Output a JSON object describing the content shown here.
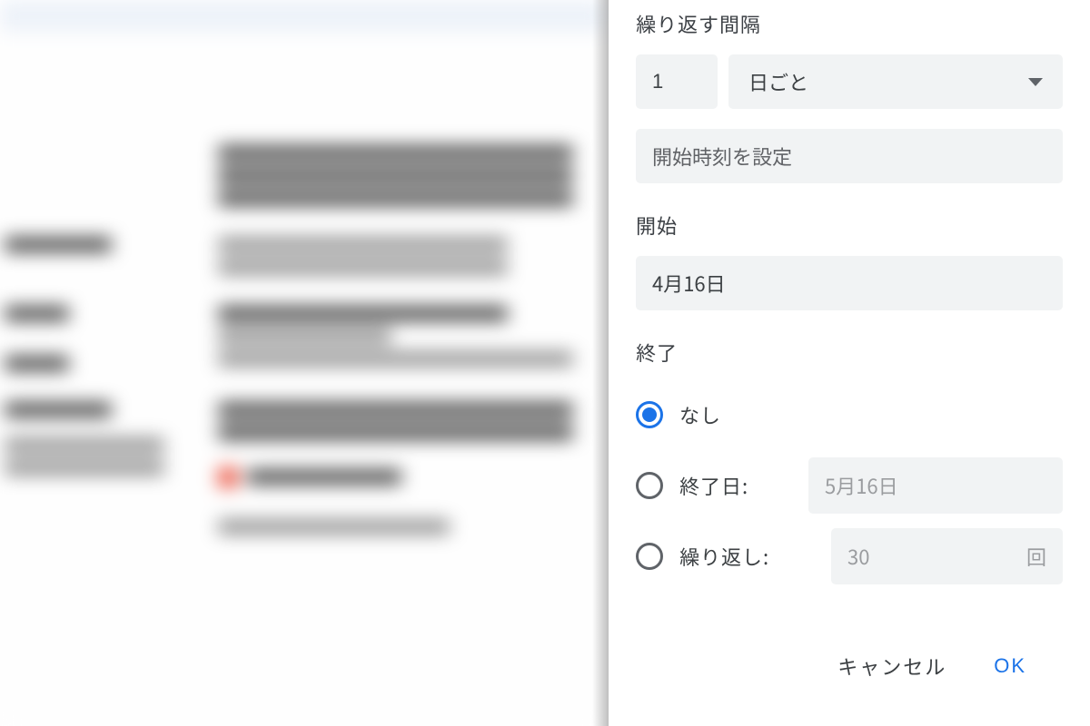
{
  "panel": {
    "interval_label": "繰り返す間隔",
    "interval_value": "1",
    "interval_unit": "日ごと",
    "start_time_placeholder": "開始時刻を設定",
    "start_label": "開始",
    "start_date": "4月16日",
    "end_label": "終了",
    "end_options": {
      "none": "なし",
      "on_date_label": "終了日:",
      "on_date_value": "5月16日",
      "after_label": "繰り返し:",
      "after_count": "30",
      "after_unit": "回"
    },
    "selected_end": "none",
    "buttons": {
      "cancel": "キャンセル",
      "ok": "OK"
    }
  }
}
